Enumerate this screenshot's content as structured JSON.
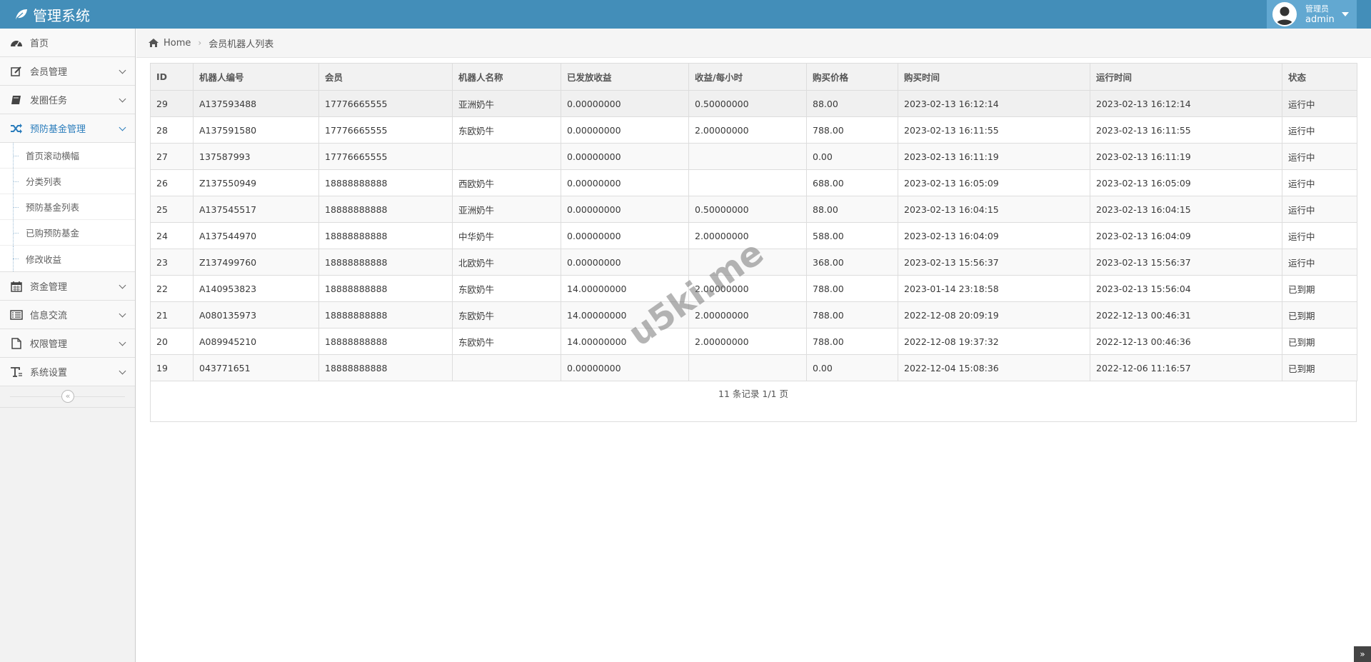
{
  "app": {
    "title": "管理系统"
  },
  "user": {
    "role": "管理员",
    "name": "admin"
  },
  "sidebar": {
    "items": [
      {
        "label": "首页",
        "icon": "dashboard-icon",
        "has_children": false
      },
      {
        "label": "会员管理",
        "icon": "edit-icon",
        "has_children": true
      },
      {
        "label": "发圈任务",
        "icon": "book-icon",
        "has_children": true
      },
      {
        "label": "预防基金管理",
        "icon": "random-icon",
        "has_children": true,
        "active": true
      },
      {
        "label": "资金管理",
        "icon": "calendar-icon",
        "has_children": true
      },
      {
        "label": "信息交流",
        "icon": "list-icon",
        "has_children": true
      },
      {
        "label": "权限管理",
        "icon": "file-icon",
        "has_children": true
      },
      {
        "label": "系统设置",
        "icon": "text-icon",
        "has_children": true
      }
    ],
    "submenu": [
      "首页滚动横幅",
      "分类列表",
      "预防基金列表",
      "已购预防基金",
      "修改收益"
    ],
    "collapse_glyph": "«"
  },
  "breadcrumb": {
    "home": "Home",
    "current": "会员机器人列表"
  },
  "table": {
    "headers": [
      "ID",
      "机器人编号",
      "会员",
      "机器人名称",
      "已发放收益",
      "收益/每小时",
      "购买价格",
      "购买时间",
      "运行时间",
      "状态"
    ],
    "rows": [
      [
        "29",
        "A137593488",
        "17776665555",
        "亚洲奶牛",
        "0.00000000",
        "0.50000000",
        "88.00",
        "2023-02-13 16:12:14",
        "2023-02-13 16:12:14",
        "运行中"
      ],
      [
        "28",
        "A137591580",
        "17776665555",
        "东欧奶牛",
        "0.00000000",
        "2.00000000",
        "788.00",
        "2023-02-13 16:11:55",
        "2023-02-13 16:11:55",
        "运行中"
      ],
      [
        "27",
        "137587993",
        "17776665555",
        "",
        "0.00000000",
        "",
        "0.00",
        "2023-02-13 16:11:19",
        "2023-02-13 16:11:19",
        "运行中"
      ],
      [
        "26",
        "Z137550949",
        "18888888888",
        "西欧奶牛",
        "0.00000000",
        "",
        "688.00",
        "2023-02-13 16:05:09",
        "2023-02-13 16:05:09",
        "运行中"
      ],
      [
        "25",
        "A137545517",
        "18888888888",
        "亚洲奶牛",
        "0.00000000",
        "0.50000000",
        "88.00",
        "2023-02-13 16:04:15",
        "2023-02-13 16:04:15",
        "运行中"
      ],
      [
        "24",
        "A137544970",
        "18888888888",
        "中华奶牛",
        "0.00000000",
        "2.00000000",
        "588.00",
        "2023-02-13 16:04:09",
        "2023-02-13 16:04:09",
        "运行中"
      ],
      [
        "23",
        "Z137499760",
        "18888888888",
        "北欧奶牛",
        "0.00000000",
        "",
        "368.00",
        "2023-02-13 15:56:37",
        "2023-02-13 15:56:37",
        "运行中"
      ],
      [
        "22",
        "A140953823",
        "18888888888",
        "东欧奶牛",
        "14.00000000",
        "2.00000000",
        "788.00",
        "2023-01-14 23:18:58",
        "2023-02-13 15:56:04",
        "已到期"
      ],
      [
        "21",
        "A080135973",
        "18888888888",
        "东欧奶牛",
        "14.00000000",
        "2.00000000",
        "788.00",
        "2022-12-08 20:09:19",
        "2022-12-13 00:46:31",
        "已到期"
      ],
      [
        "20",
        "A089945210",
        "18888888888",
        "东欧奶牛",
        "14.00000000",
        "2.00000000",
        "788.00",
        "2022-12-08 19:37:32",
        "2022-12-13 00:46:36",
        "已到期"
      ],
      [
        "19",
        "043771651",
        "18888888888",
        "",
        "0.00000000",
        "",
        "0.00",
        "2022-12-04 15:08:36",
        "2022-12-06 11:16:57",
        "已到期"
      ]
    ]
  },
  "pagination": {
    "text": "11 条记录 1/1 页"
  },
  "watermark": "u5ki.me",
  "back_to_top_glyph": "»",
  "colors": {
    "navbar": "#438eb9",
    "user_box": "#62a8d1",
    "active": "#2b7dbc"
  }
}
